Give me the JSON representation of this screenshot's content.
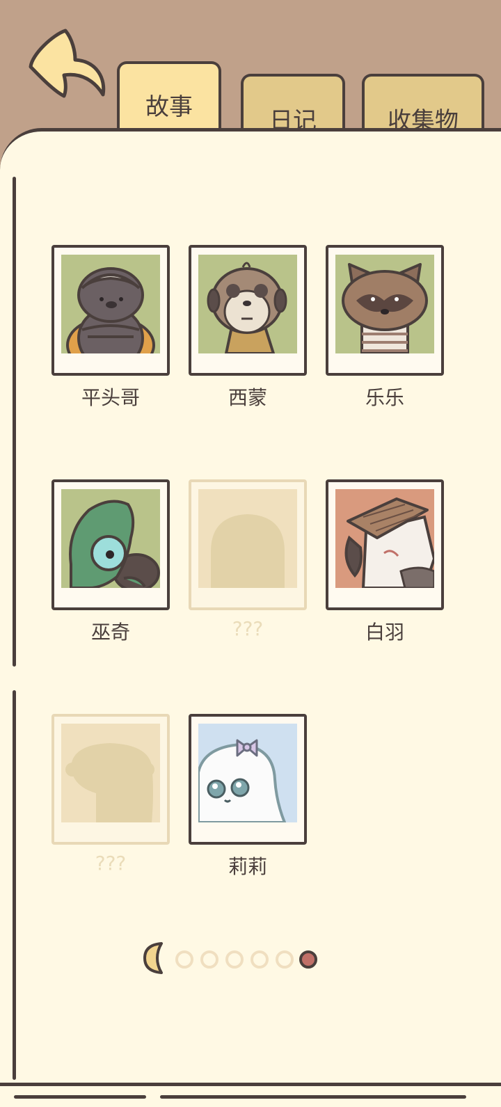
{
  "tabs": {
    "story": "故事",
    "diary": "日记",
    "collection": "收集物"
  },
  "characters": [
    {
      "name": "平头哥",
      "locked": false,
      "icon": "honey-badger"
    },
    {
      "name": "西蒙",
      "locked": false,
      "icon": "meerkat"
    },
    {
      "name": "乐乐",
      "locked": false,
      "icon": "raccoon-dog"
    },
    {
      "name": "巫奇",
      "locked": false,
      "icon": "chameleon"
    },
    {
      "name": "???",
      "locked": true,
      "icon": "silhouette"
    },
    {
      "name": "白羽",
      "locked": false,
      "icon": "bird-with-hat"
    },
    {
      "name": "???",
      "locked": true,
      "icon": "silhouette"
    },
    {
      "name": "莉莉",
      "locked": false,
      "icon": "ghost-with-bow"
    }
  ],
  "pagination": {
    "total_dots": 6,
    "current": 6
  },
  "colors": {
    "outline": "#4a3f3c",
    "paper": "#fff9e4",
    "background": "#c0a18a",
    "tab": "#f2d58f",
    "photo_green": "#b9c38a",
    "photo_orange": "#d99a7e",
    "photo_blue": "#cfe0f0"
  }
}
